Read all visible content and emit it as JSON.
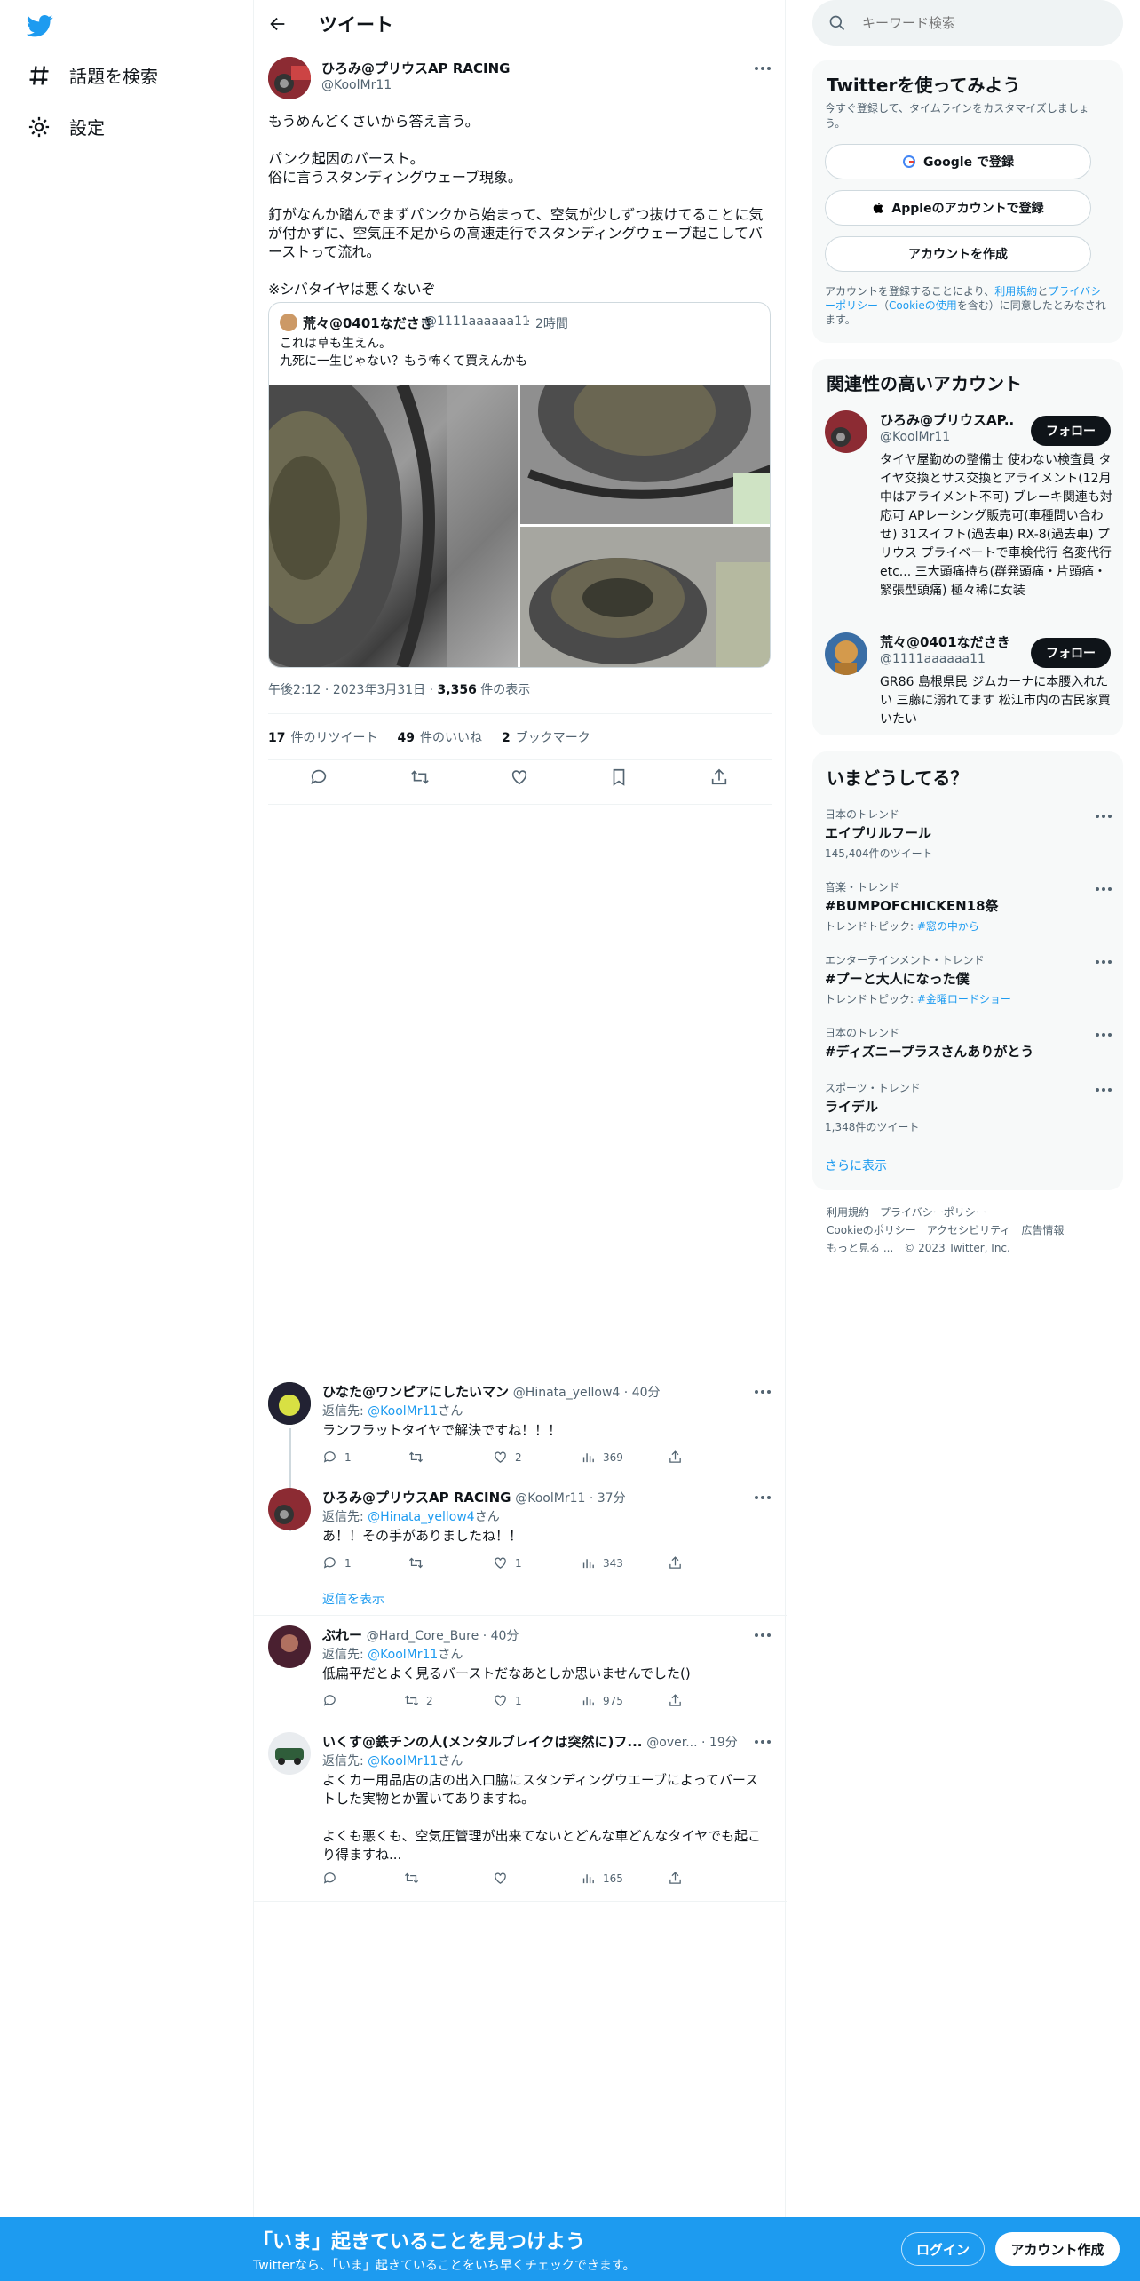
{
  "nav": {
    "explore": "話題を検索",
    "settings": "設定"
  },
  "header": {
    "title": "ツイート"
  },
  "tweet": {
    "name": "ひろみ@プリウスAP RACING",
    "handle": "@KoolMr11",
    "text": "もうめんどくさいから答え言う。\n\nパンク起因のバースト。\n俗に言うスタンディングウェーブ現象。\n\n釘がなんか踏んでまずパンクから始まって、空気が少しずつ抜けてることに気が付かずに、空気圧不足からの高速走行でスタンディングウェーブ起こしてバーストって流れ。\n\n※シバタイヤは悪くないぞ",
    "quote": {
      "name": "荒々@0401なださき",
      "handle": "@1111aaaaaa11",
      "time": "2時間",
      "text": "これは草も生えん。\n九死に一生じゃない？もう怖くて買えんかも"
    },
    "time": "午後2:12",
    "date": "2023年3月31日",
    "views": "3,356",
    "views_label": "件の表示",
    "retweets": "17",
    "retweets_label": "件のリツイート",
    "likes": "49",
    "likes_label": "件のいいね",
    "bookmarks": "2",
    "bookmarks_label": "ブックマーク"
  },
  "replies": [
    {
      "name": "ひなた@ワンピアにしたいマン",
      "handle": "@Hinata_yellow4",
      "time": "40分",
      "to": "@KoolMr11",
      "text": "ランフラットタイヤで解決ですね！！！",
      "reply_count": "1",
      "rt_count": "",
      "like_count": "2",
      "views": "369"
    },
    {
      "name": "ひろみ@プリウスAP RACING",
      "handle": "@KoolMr11",
      "time": "37分",
      "to": "@Hinata_yellow4",
      "text": "あ！！その手がありましたね！！",
      "reply_count": "1",
      "rt_count": "",
      "like_count": "1",
      "views": "343"
    },
    {
      "name": "ぶれー",
      "handle": "@Hard_Core_Bure",
      "time": "40分",
      "to": "@KoolMr11",
      "text": "低扁平だとよく見るバーストだなあとしか思いませんでした()",
      "reply_count": "",
      "rt_count": "2",
      "like_count": "1",
      "views": "975"
    },
    {
      "name": "いくす@鉄チンの人(メンタルブレイクは突然に)フ...",
      "handle": "@over...",
      "time": "19分",
      "to": "@KoolMr11",
      "text": "よくカー用品店の店の出入口脇にスタンディングウエーブによってバーストした実物とか置いてありますね。\n\nよくも悪くも、空気圧管理が出来てないとどんな車どんなタイヤでも起こり得ますね...",
      "reply_count": "",
      "rt_count": "",
      "like_count": "",
      "views": "165"
    }
  ],
  "reply_to_prefix": "返信先: ",
  "reply_to_suffix": "さん",
  "show_replies": "返信を表示",
  "search": {
    "placeholder": "キーワード検索"
  },
  "signup": {
    "title": "Twitterを使ってみよう",
    "subtitle": "今すぐ登録して、タイムラインをカスタマイズしましょう。",
    "google": "Google で登録",
    "apple": "Appleのアカウントで登録",
    "create": "アカウントを作成",
    "terms_pre": "アカウントを登録することにより、",
    "terms_link": "利用規約",
    "terms_and": "と",
    "privacy_link": "プライバシーポリシー",
    "terms_paren": "（",
    "cookie_link": "Cookieの使用",
    "terms_post": "を含む）に同意したとみなされます。"
  },
  "related": {
    "title": "関連性の高いアカウント",
    "follow": "フォロー",
    "accounts": [
      {
        "name": "ひろみ@プリウスAP...",
        "handle": "@KoolMr11",
        "bio": "タイヤ屋勤めの整備士 使わない検査員 タイヤ交換とサス交換とアライメント(12月中はアライメント不可) ブレーキ関連も対応可 APレーシング販売可(車種問い合わせ) 31スイフト(過去車) RX-8(過去車) プリウス プライベートで車検代行 名変代行etc... 三大頭痛持ち(群発頭痛・片頭痛・緊張型頭痛) 極々稀に女装"
      },
      {
        "name": "荒々@0401なださき",
        "handle": "@1111aaaaaa11",
        "bio": "GR86 島根県民 ジムカーナに本腰入れたい 三藤に溺れてます 松江市内の古民家買いたい"
      }
    ]
  },
  "trends": {
    "title": "いまどうしてる？",
    "items": [
      {
        "category": "日本のトレンド",
        "name": "エイプリルフール",
        "sub": "145,404件のツイート",
        "sub_link": ""
      },
      {
        "category": "音楽・トレンド",
        "name": "#BUMPOFCHICKEN18祭",
        "sub": "トレンドトピック: ",
        "sub_link": "#窓の中から"
      },
      {
        "category": "エンターテインメント・トレンド",
        "name": "#プーと大人になった僕",
        "sub": "トレンドトピック: ",
        "sub_link": "#金曜ロードショー"
      },
      {
        "category": "日本のトレンド",
        "name": "#ディズニープラスさんありがとう",
        "sub": "",
        "sub_link": ""
      },
      {
        "category": "スポーツ・トレンド",
        "name": "ライデル",
        "sub": "1,348件のツイート",
        "sub_link": ""
      }
    ],
    "more": "さらに表示"
  },
  "footer": {
    "links": [
      "利用規約",
      "プライバシーポリシー",
      "Cookieのポリシー",
      "アクセシビリティ",
      "広告情報",
      "もっと見る ..."
    ],
    "copyright": "© 2023 Twitter, Inc."
  },
  "banner": {
    "title": "「いま」起きていることを見つけよう",
    "subtitle": "Twitterなら、「いま」起きていることをいち早くチェックできます。",
    "login": "ログイン",
    "signup": "アカウント作成"
  },
  "colors": {
    "accent": "#1d9bf0",
    "text": "#0f1419",
    "muted": "#536471"
  }
}
